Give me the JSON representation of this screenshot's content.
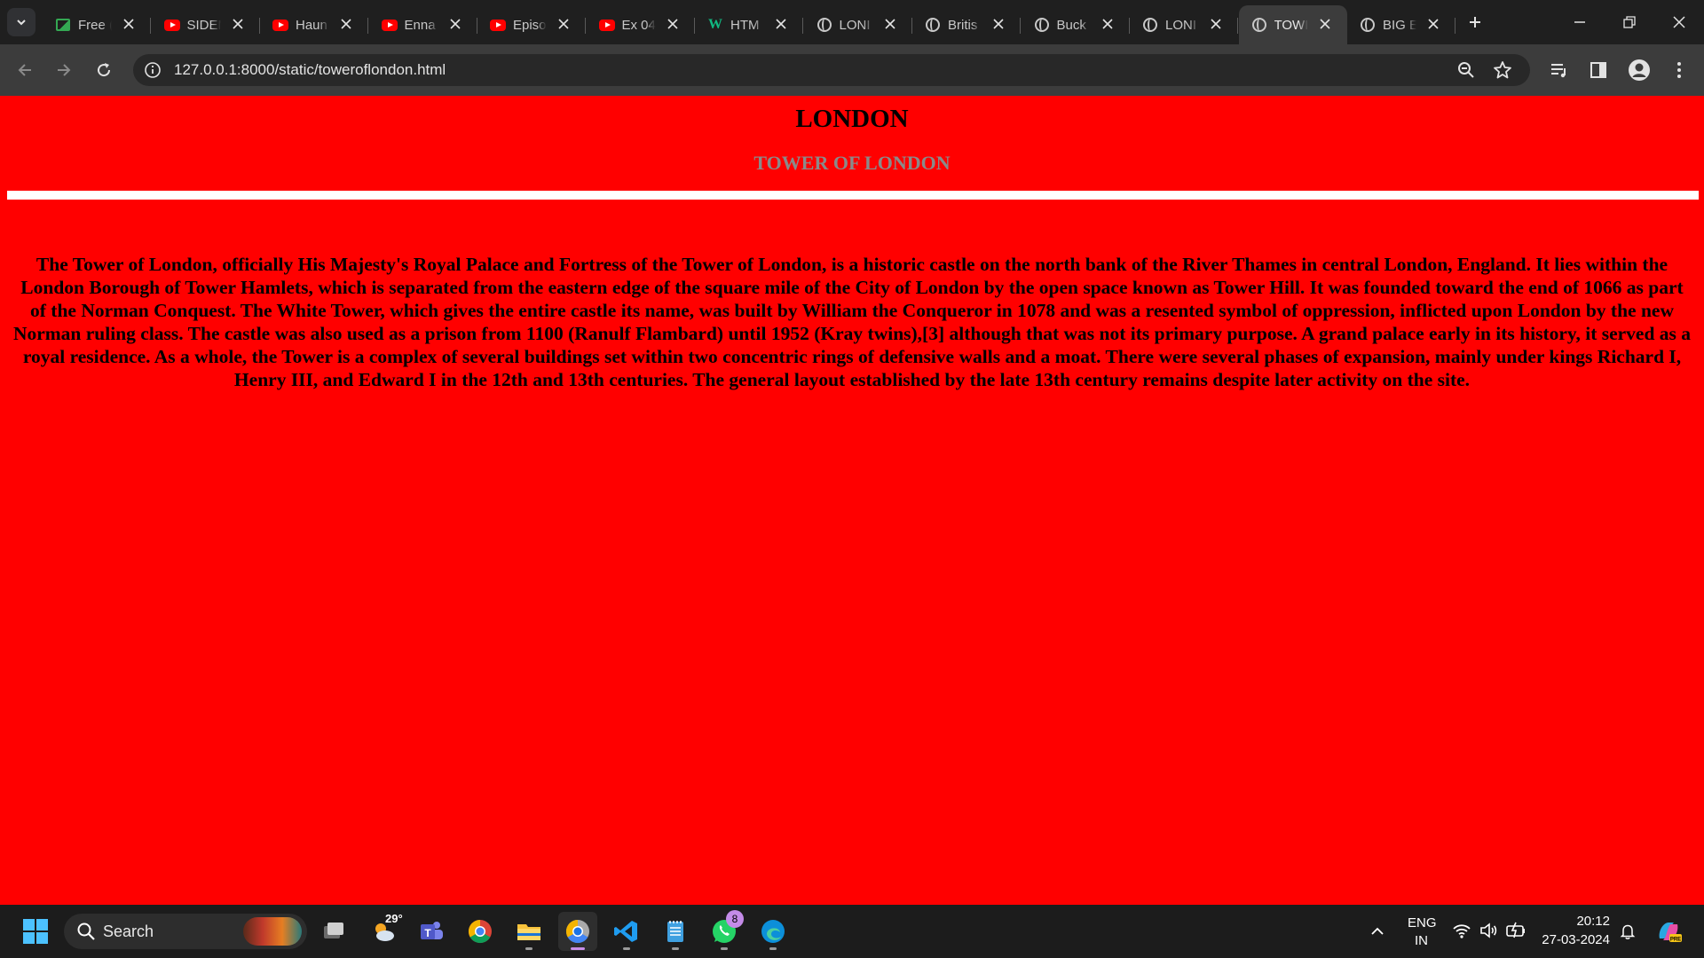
{
  "browser": {
    "tabs": [
      {
        "title": "Free (",
        "icon": "image-icon"
      },
      {
        "title": "SIDEM",
        "icon": "youtube-icon"
      },
      {
        "title": "Haun",
        "icon": "youtube-icon"
      },
      {
        "title": "Enna",
        "icon": "youtube-icon"
      },
      {
        "title": "Episo",
        "icon": "youtube-icon"
      },
      {
        "title": "Ex 04",
        "icon": "youtube-icon"
      },
      {
        "title": "HTM",
        "icon": "w3schools-icon"
      },
      {
        "title": "LONI",
        "icon": "globe-icon"
      },
      {
        "title": "Britis",
        "icon": "globe-icon"
      },
      {
        "title": "Buck",
        "icon": "globe-icon"
      },
      {
        "title": "LONI",
        "icon": "globe-icon"
      },
      {
        "title": "TOWI",
        "icon": "globe-icon",
        "active": true
      },
      {
        "title": "BIG E",
        "icon": "globe-icon"
      }
    ],
    "url": "127.0.0.1:8000/static/toweroflondon.html"
  },
  "page": {
    "heading": "LONDON",
    "subheading": "TOWER OF LONDON",
    "paragraph": "The Tower of London, officially His Majesty's Royal Palace and Fortress of the Tower of London, is a historic castle on the north bank of the River Thames in central London, England. It lies within the London Borough of Tower Hamlets, which is separated from the eastern edge of the square mile of the City of London by the open space known as Tower Hill. It was founded toward the end of 1066 as part of the Norman Conquest. The White Tower, which gives the entire castle its name, was built by William the Conqueror in 1078 and was a resented symbol of oppression, inflicted upon London by the new Norman ruling class. The castle was also used as a prison from 1100 (Ranulf Flambard) until 1952 (Kray twins),[3] although that was not its primary purpose. A grand palace early in its history, it served as a royal residence. As a whole, the Tower is a complex of several buildings set within two concentric rings of defensive walls and a moat. There were several phases of expansion, mainly under kings Richard I, Henry III, and Edward I in the 12th and 13th centuries. The general layout established by the late 13th century remains despite later activity on the site.",
    "background_color": "#ff0000",
    "subheading_color": "#8a8a8a"
  },
  "taskbar": {
    "search_label": "Search",
    "weather_temp": "29°",
    "whatsapp_badge": "8",
    "language": "ENG",
    "region": "IN",
    "time": "20:12",
    "date": "27-03-2024"
  }
}
